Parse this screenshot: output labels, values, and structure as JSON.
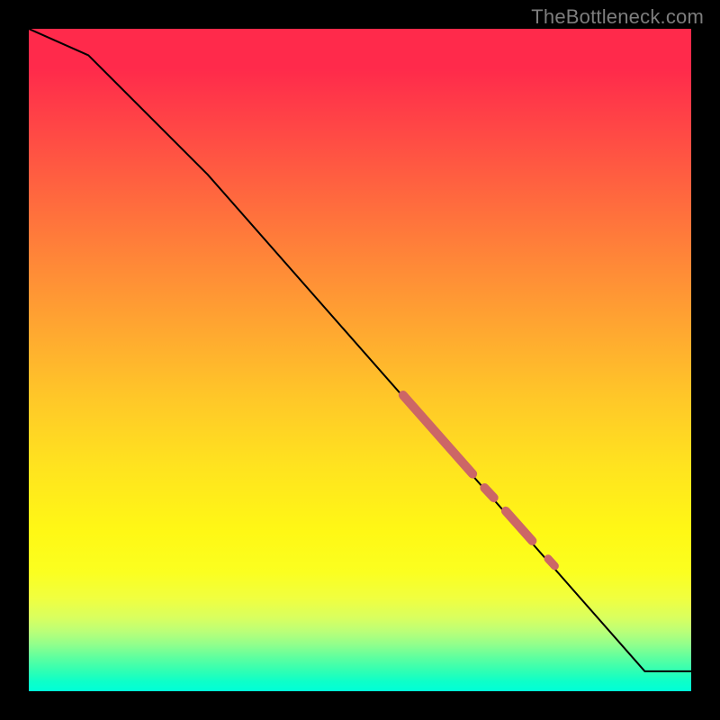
{
  "watermark": "TheBottleneck.com",
  "chart_data": {
    "type": "line",
    "title": "",
    "xlabel": "",
    "ylabel": "",
    "xlim": [
      0,
      100
    ],
    "ylim": [
      0,
      100
    ],
    "grid": false,
    "line": {
      "x": [
        0,
        9,
        27,
        93,
        100
      ],
      "y": [
        100,
        96,
        78,
        3,
        3
      ],
      "color": "#000000",
      "width": 2
    },
    "highlight_segments": [
      {
        "x": [
          56.5,
          67.0
        ],
        "y": [
          44.7,
          32.8
        ],
        "color": "#cc6666",
        "width": 10
      },
      {
        "x": [
          68.8,
          70.2
        ],
        "y": [
          30.7,
          29.2
        ],
        "color": "#cc6666",
        "width": 10
      },
      {
        "x": [
          72.0,
          76.0
        ],
        "y": [
          27.2,
          22.7
        ],
        "color": "#cc6666",
        "width": 10
      },
      {
        "x": [
          78.4,
          79.4
        ],
        "y": [
          20.0,
          18.9
        ],
        "color": "#cc6666",
        "width": 9
      }
    ],
    "background_gradient": {
      "stops": [
        {
          "pos": 0.0,
          "color": "#ff2a4b"
        },
        {
          "pos": 0.5,
          "color": "#ffc828"
        },
        {
          "pos": 0.8,
          "color": "#fbff20"
        },
        {
          "pos": 1.0,
          "color": "#00ffd8"
        }
      ],
      "direction": "top-to-bottom"
    }
  }
}
